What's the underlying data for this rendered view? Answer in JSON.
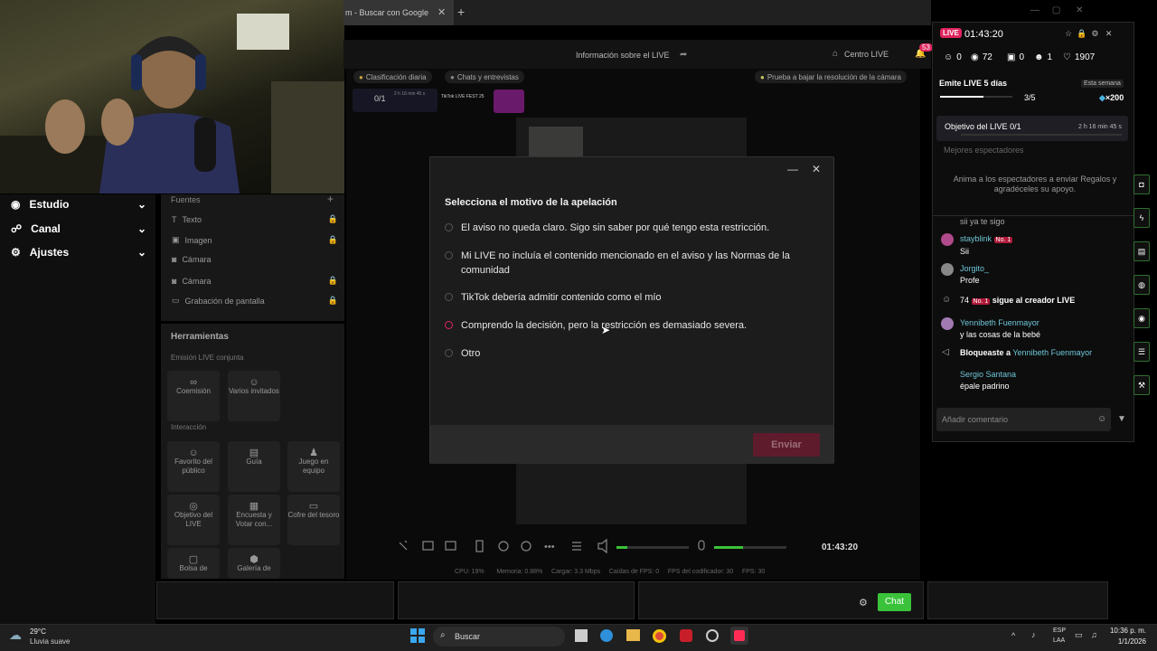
{
  "browser": {
    "tab_title": "m - Buscar con Google",
    "close_glyph": "✕",
    "new_tab_glyph": "+"
  },
  "header": {
    "title": "Información sobre el LIVE",
    "centro": "Centro LIVE",
    "notif_count": "53"
  },
  "top_row": {
    "clasificacion": "Clasificación diaria",
    "chats": "Chats y entrevistas",
    "prueba": "Prueba a bajar la resolución de la cámara",
    "progress_text": "0/1",
    "timer_small": "2 h 16 min 45 s",
    "fest_label": "TikTok LIVE FEST 25"
  },
  "sidebar": {
    "items": [
      {
        "label": "Estudio",
        "icon": "studio-icon"
      },
      {
        "label": "Canal",
        "icon": "channel-icon"
      },
      {
        "label": "Ajustes",
        "icon": "gear-icon"
      }
    ]
  },
  "sources": {
    "title": "Fuentes",
    "items": [
      {
        "label": "Texto",
        "locked": true
      },
      {
        "label": "Imagen",
        "locked": true
      },
      {
        "label": "Cámara",
        "locked": false
      },
      {
        "label": "Cámara",
        "locked": true
      },
      {
        "label": "Grabación de pantalla",
        "locked": true
      }
    ]
  },
  "tools": {
    "title": "Herramientas",
    "section_joint": "Emisión LIVE conjunta",
    "section_interaction": "Interacción",
    "cards": [
      "Coemisión",
      "Varios invitados",
      "Favorito del público",
      "Guía",
      "Juego en equipo",
      "Objetivo del LIVE",
      "Encuesta y Votar con...",
      "Cofre del tesoro",
      "Bolsa de",
      "Galería de"
    ]
  },
  "modal": {
    "title": "Selecciona el motivo de la apelación",
    "options": [
      "El aviso no queda claro. Sigo sin saber por qué tengo esta restricción.",
      "Mi LIVE no incluía el contenido mencionado en el aviso y las Normas de la comunidad",
      "TikTok debería admitir contenido como el mío",
      "Comprendo la decisión, pero la restricción es demasiado severa.",
      "Otro"
    ],
    "submit": "Enviar",
    "minimize": "—",
    "close": "✕"
  },
  "controls": {
    "timer": "01:43:20",
    "mic_level": 0.4,
    "speaker_level": 0.15
  },
  "stats": {
    "cpu": "CPU: 19%",
    "memoria": "Memoria: 0.88%",
    "cargar": "Cargar: 3.3 Mbps",
    "caidas": "Caídas de FPS: 0",
    "fps_cod": "FPS del codificador: 30",
    "fps": "FPS: 30"
  },
  "live": {
    "pill": "LIVE",
    "time": "01:43:20",
    "viewers": "0",
    "views": "72",
    "gifts": "0",
    "new_followers": "1",
    "likes": "1907",
    "streak_title": "Emite LIVE 5 días",
    "streak_badge": "Esta semana",
    "streak_progress": "3/5",
    "streak_reward": "×200",
    "objective": "Objetivo del LIVE",
    "objective_progress": "0/1",
    "objective_time": "2 h 16 min 45 s",
    "best_viewers": "Mejores espectadores",
    "encourage": "Anima a los espectadores a enviar Regalos y agradéceles su apoyo.",
    "comment_placeholder": "Añadir comentario"
  },
  "chat": [
    {
      "user": "",
      "text": "sii ya te sigo"
    },
    {
      "user": "stayblink",
      "badge": "No. 1",
      "text": "Sii"
    },
    {
      "user": "Jorgito_",
      "text": "Profe"
    },
    {
      "user": "74",
      "badge": "No. 1",
      "text": "sigue al creador LIVE"
    },
    {
      "user": "Yennibeth Fuenmayor",
      "text": "y las cosas de la bebé"
    },
    {
      "user": "Bloqueaste a",
      "text": "Yennibeth Fuenmayor"
    },
    {
      "user": "Sergio Santana",
      "text": "épale padrino"
    }
  ],
  "bottom": {
    "chat_button": "Chat"
  },
  "taskbar": {
    "weather_temp": "29°C",
    "weather_desc": "Lluvia suave",
    "search": "Buscar",
    "lang": "ESP",
    "lang2": "LAA",
    "time": "10:36 p. m.",
    "date": "1/1/2026"
  }
}
